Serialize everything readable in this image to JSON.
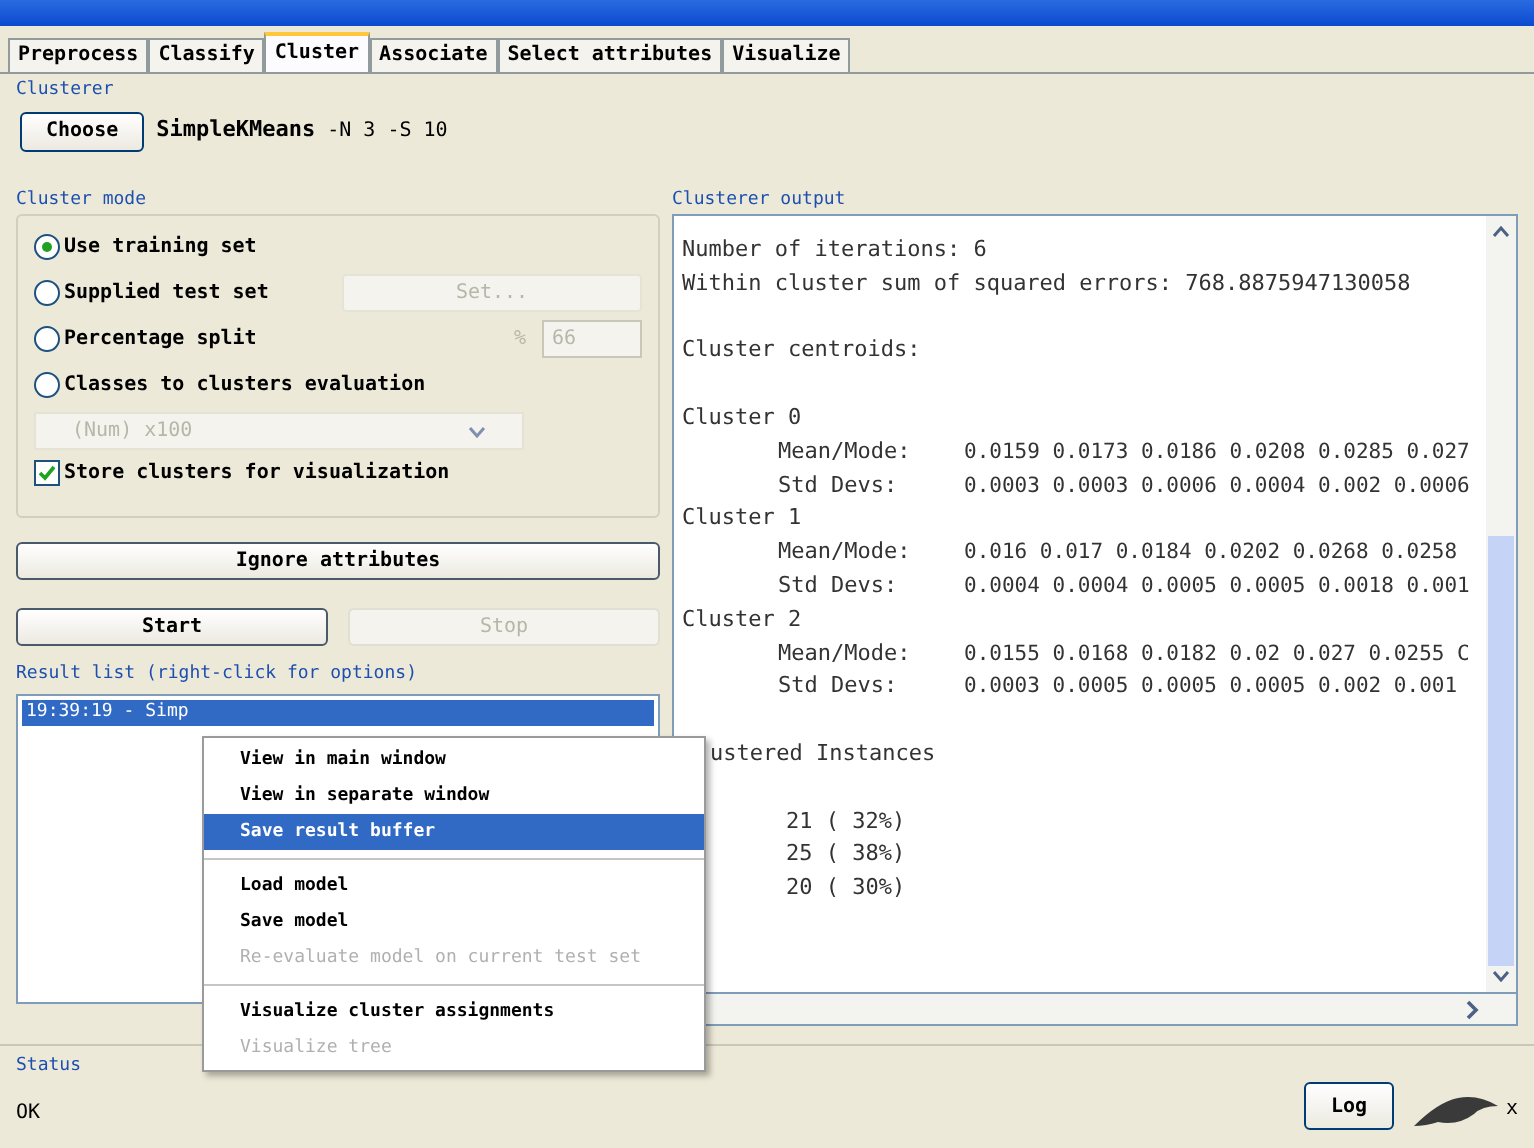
{
  "tabs": [
    {
      "label": "Preprocess",
      "selected": false
    },
    {
      "label": "Classify",
      "selected": false
    },
    {
      "label": "Cluster",
      "selected": true
    },
    {
      "label": "Associate",
      "selected": false
    },
    {
      "label": "Select attributes",
      "selected": false
    },
    {
      "label": "Visualize",
      "selected": false
    }
  ],
  "clusterer": {
    "title": "Clusterer",
    "choose_button": "Choose",
    "scheme": "SimpleKMeans",
    "options": "-N 3 -S 10"
  },
  "cluster_mode": {
    "title": "Cluster mode",
    "options": [
      {
        "label": "Use training set",
        "selected": true
      },
      {
        "label": "Supplied test set",
        "selected": false
      },
      {
        "label": "Percentage split",
        "selected": false
      },
      {
        "label": "Classes to clusters evaluation",
        "selected": false
      }
    ],
    "set_button": "Set...",
    "percent_label": "%",
    "percent_value": "66",
    "class_dropdown": "(Num) x100",
    "store_checkbox": {
      "label": "Store clusters for visualization",
      "checked": true
    }
  },
  "ignore_button": "Ignore attributes",
  "start_button": {
    "label": "Start",
    "disabled": false
  },
  "stop_button": {
    "label": "Stop",
    "disabled": true
  },
  "result_list": {
    "title": "Result list (right-click for options)",
    "items": [
      {
        "label": "19:39:19 - Simp",
        "selected": true
      }
    ]
  },
  "output": {
    "title": "Clusterer output",
    "lines": [
      {
        "kind": "text",
        "text": "Number of iterations: 6"
      },
      {
        "kind": "text",
        "text": "Within cluster sum of squared errors: 768.8875947130058"
      },
      {
        "kind": "blank"
      },
      {
        "kind": "text",
        "text": "Cluster centroids:"
      },
      {
        "kind": "blank"
      },
      {
        "kind": "text",
        "text": "Cluster 0"
      },
      {
        "kind": "stat",
        "label": "Mean/Mode:",
        "values": "0.0159 0.0173 0.0186 0.0208 0.0285 0.027"
      },
      {
        "kind": "stat",
        "label": "Std Devs:",
        "values": "0.0003 0.0003 0.0006 0.0004 0.002 0.0006"
      },
      {
        "kind": "text",
        "text": "Cluster 1"
      },
      {
        "kind": "stat",
        "label": "Mean/Mode:",
        "values": "0.016 0.017 0.0184 0.0202 0.0268 0.0258"
      },
      {
        "kind": "stat",
        "label": "Std Devs:",
        "values": "0.0004 0.0004 0.0005 0.0005 0.0018 0.001"
      },
      {
        "kind": "text",
        "text": "Cluster 2"
      },
      {
        "kind": "stat",
        "label": "Mean/Mode:",
        "values": "0.0155 0.0168 0.0182 0.02 0.027 0.0255 C"
      },
      {
        "kind": "stat",
        "label": "Std Devs:",
        "values": "0.0003 0.0005 0.0005 0.0005 0.002 0.001"
      },
      {
        "kind": "blank"
      },
      {
        "kind": "partial",
        "text": "ustered Instances"
      },
      {
        "kind": "blank"
      },
      {
        "kind": "count",
        "text": "21 ( 32%)"
      },
      {
        "kind": "count",
        "text": "25 ( 38%)"
      },
      {
        "kind": "count",
        "text": "20 ( 30%)"
      }
    ]
  },
  "context_menu": {
    "groups": [
      [
        {
          "label": "View in main window",
          "selected": false,
          "disabled": false
        },
        {
          "label": "View in separate window",
          "selected": false,
          "disabled": false
        },
        {
          "label": "Save result buffer",
          "selected": true,
          "disabled": false
        }
      ],
      [
        {
          "label": "Load model",
          "selected": false,
          "disabled": false
        },
        {
          "label": "Save model",
          "selected": false,
          "disabled": false
        },
        {
          "label": "Re-evaluate model on current test set",
          "selected": false,
          "disabled": true
        }
      ],
      [
        {
          "label": "Visualize cluster assignments",
          "selected": false,
          "disabled": false
        },
        {
          "label": "Visualize tree",
          "selected": false,
          "disabled": true
        }
      ]
    ]
  },
  "status": {
    "title": "Status",
    "text": "OK",
    "log_button": "Log",
    "count": "x"
  }
}
